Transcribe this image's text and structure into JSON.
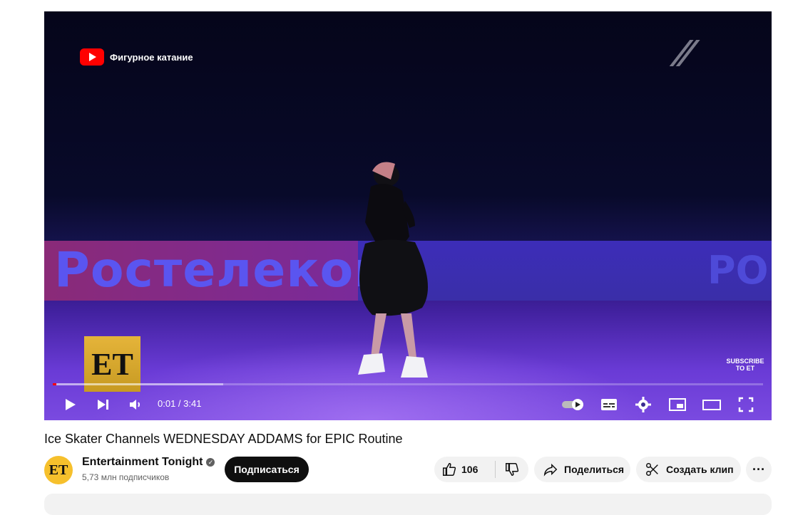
{
  "video": {
    "brand_text": "Фигурное катание",
    "board_text": "Ростелеком",
    "board_text_right": "РО",
    "et_logo": "ET",
    "subscribe_overlay_line1": "SUBSCRIBE",
    "subscribe_overlay_line2": "TO ET",
    "current_time": "0:01",
    "duration": "3:41",
    "time_display": "0:01 / 3:41",
    "played_fraction": 0.005,
    "loaded_fraction": 0.24
  },
  "meta": {
    "title": "Ice Skater Channels WEDNESDAY ADDAMS for EPIC Routine"
  },
  "channel": {
    "name": "Entertainment Tonight",
    "avatar_text": "ET",
    "subscribers": "5,73 млн подписчиков",
    "subscribe_label": "Подписаться"
  },
  "actions": {
    "like_count": "106",
    "share_label": "Поделиться",
    "clip_label": "Создать клип",
    "more_label": "···"
  },
  "icons": {
    "play": "play-icon",
    "next": "next-icon",
    "volume": "volume-icon",
    "autoplay": "autoplay-toggle-icon",
    "captions": "captions-icon",
    "settings": "gear-icon",
    "miniplayer": "miniplayer-icon",
    "theater": "theater-icon",
    "fullscreen": "fullscreen-icon",
    "like": "thumbs-up-icon",
    "dislike": "thumbs-down-icon",
    "share": "share-arrow-icon",
    "clip": "scissors-icon",
    "verified": "verified-check-icon"
  },
  "colors": {
    "accent": "#ff0000",
    "subscribe_bg": "#0f0f0f",
    "pill_bg": "#f2f2f2",
    "et_gold": "#f6c02c"
  }
}
